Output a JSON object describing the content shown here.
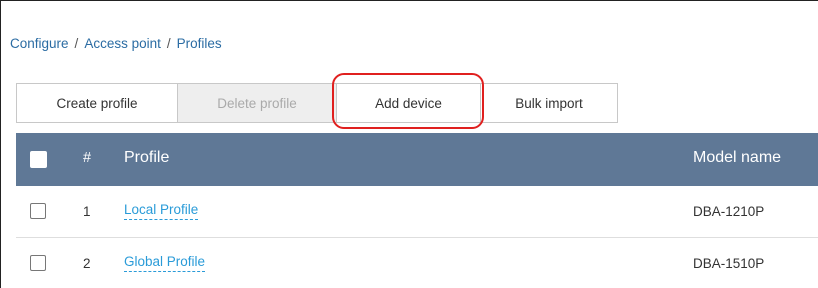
{
  "breadcrumb": [
    "Configure",
    "Access point",
    "Profiles"
  ],
  "breadcrumb_separator": "/",
  "toolbar": {
    "create_label": "Create profile",
    "delete_label": "Delete profile",
    "add_device_label": "Add device",
    "bulk_import_label": "Bulk import"
  },
  "table": {
    "headers": {
      "number": "#",
      "profile": "Profile",
      "model": "Model name"
    },
    "rows": [
      {
        "num": "1",
        "profile": "Local Profile",
        "model": "DBA-1210P"
      },
      {
        "num": "2",
        "profile": "Global Profile",
        "model": "DBA-1510P"
      }
    ]
  },
  "colors": {
    "header_bg": "#5f7896",
    "link": "#2a9bd8",
    "highlight": "#e0201f",
    "disabled_bg": "#eeeeee"
  }
}
